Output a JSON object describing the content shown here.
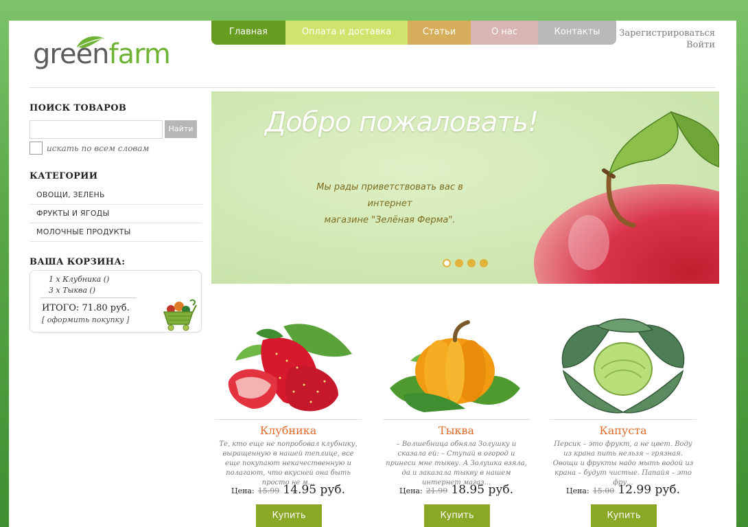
{
  "logo": {
    "part1": "green",
    "part2": "farm"
  },
  "nav": [
    {
      "label": "Главная"
    },
    {
      "label": "Оплата и доставка"
    },
    {
      "label": "Статьи"
    },
    {
      "label": "О нас"
    },
    {
      "label": "Контакты"
    }
  ],
  "auth": {
    "register": "Зарегистрироваться",
    "login": "Войти"
  },
  "search": {
    "heading": "ПОИСК ТОВАРОВ",
    "value": "",
    "button": "Найти",
    "all_words_label": "искать по всем словам"
  },
  "categories": {
    "heading": "КАТЕГОРИИ",
    "items": [
      {
        "label": "ОВОЩИ, ЗЕЛЕНЬ"
      },
      {
        "label": "ФРУКТЫ И ЯГОДЫ"
      },
      {
        "label": "МОЛОЧНЫЕ ПРОДУКТЫ"
      }
    ]
  },
  "cart": {
    "heading": "ВАША КОРЗИНА:",
    "lines": [
      "1 x Клубника ()",
      "3 x Тыква ()"
    ],
    "total": "ИТОГО: 71.80 руб.",
    "checkout": "[ оформить покупку ]"
  },
  "banner": {
    "title": "Добро пожаловать!",
    "subtitle_line1": "Мы рады приветствовать вас в интернет",
    "subtitle_line2": "магазине \"Зелёная Ферма\".",
    "slides": 4,
    "active_slide": 1
  },
  "products": [
    {
      "title": "Клубника",
      "desc": "Те, кто еще не попробовал клубнику, выращенную в нашей теплице, все еще покупают некачественную и полагают, что вкусней она быть просто не м...",
      "price_label": "Цена:",
      "old_price": "15.99",
      "new_price": "14.95 руб.",
      "buy": "Купить"
    },
    {
      "title": "Тыква",
      "desc": "– Волшебница обняла Золушку и сказала ей: – Ступай в огород и принеси мне тыкву. А Золушка взяла, да и заказала тыкву в нашем интернет магаз...",
      "price_label": "Цена:",
      "old_price": "21.99",
      "new_price": "18.95 руб.",
      "buy": "Купить"
    },
    {
      "title": "Капуста",
      "desc": "Персик – это фрукт, а не цвет. Воду из крана пить нельзя – грязная. Овощи и фрукты надо мыть водой из крана – будут чистые. Папайя – это фру...",
      "price_label": "Цена:",
      "old_price": "15.00",
      "new_price": "12.99 руб.",
      "buy": "Купить"
    }
  ]
}
